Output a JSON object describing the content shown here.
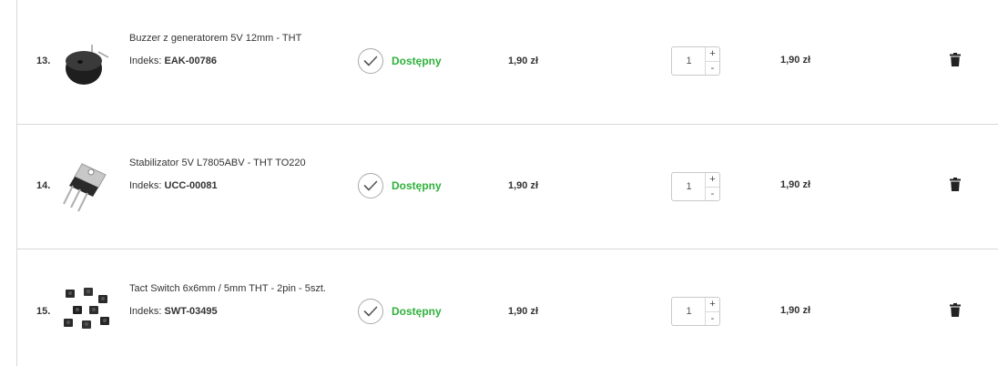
{
  "cart": {
    "rows": [
      {
        "number": "13.",
        "name": "Buzzer z generatorem 5V 12mm - THT",
        "index_label": "Indeks:",
        "index_code": "EAK-00786",
        "availability": "Dostępny",
        "price": "1,90 zł",
        "quantity": "1",
        "plus": "+",
        "minus": "-",
        "total": "1,90 zł",
        "image": "buzzer-image"
      },
      {
        "number": "14.",
        "name": "Stabilizator 5V L7805ABV - THT TO220",
        "index_label": "Indeks:",
        "index_code": "UCC-00081",
        "availability": "Dostępny",
        "price": "1,90 zł",
        "quantity": "1",
        "plus": "+",
        "minus": "-",
        "total": "1,90 zł",
        "image": "voltage-regulator-image"
      },
      {
        "number": "15.",
        "name": "Tact Switch 6x6mm / 5mm THT - 2pin - 5szt.",
        "index_label": "Indeks:",
        "index_code": "SWT-03495",
        "availability": "Dostępny",
        "price": "1,90 zł",
        "quantity": "1",
        "plus": "+",
        "minus": "-",
        "total": "1,90 zł",
        "image": "tact-switch-image"
      }
    ],
    "colors": {
      "available": "#2eb13a",
      "border": "#d8d8d8",
      "text": "#333333"
    }
  }
}
